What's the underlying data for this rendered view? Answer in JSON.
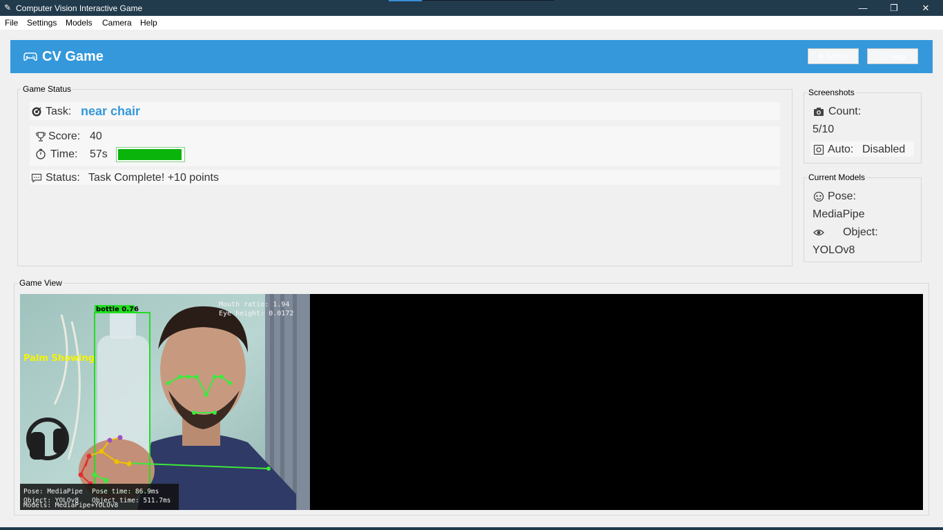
{
  "window": {
    "title": "Computer Vision Interactive Game",
    "minimize_glyph": "—",
    "maximize_glyph": "❐",
    "close_glyph": "✕"
  },
  "menu": {
    "items": [
      "File",
      "Settings",
      "Models",
      "Camera",
      "Help"
    ]
  },
  "header": {
    "title": "CV Game",
    "button_1": "⊕ Github",
    "button_2": "ⓘ Help",
    "accent": "#3498db"
  },
  "game_status": {
    "group_label": "Game Status",
    "task_label": "Task:",
    "task_value": "near chair",
    "score_label": "Score:",
    "score_value": "40",
    "time_label": "Time:",
    "time_value": "57s",
    "time_progress": 0.96,
    "status_label": "Status:",
    "status_value": "Task Complete! +10 points",
    "icons": [
      "target-icon",
      "trophy-icon",
      "stopwatch-icon",
      "chat-icon"
    ]
  },
  "screenshots": {
    "group_label": "Screenshots",
    "count_label": "Count:",
    "count_value": "5/10",
    "auto_label": "Auto:",
    "auto_value": "Disabled"
  },
  "current_models": {
    "group_label": "Current Models",
    "pose_label": "Pose:",
    "pose_value": "MediaPipe",
    "object_label": "Object:",
    "object_value": "YOLOv8"
  },
  "game_view": {
    "group_label": "Game View",
    "overlay": {
      "detection_label": "bottle 0.76",
      "gesture": "Palm Showing",
      "mouth_ratio": "Mouth ratio: 1.94",
      "eye_height": "Eye height: 0.0172",
      "pose_line": "Pose: MediaPipe",
      "pose_time": "Pose time: 86.9ms",
      "object_line": "Object: YOLOv8",
      "object_time": "Object time: 511.7ms",
      "models_line": "Models: MediaPipe+YOLOv8"
    }
  }
}
